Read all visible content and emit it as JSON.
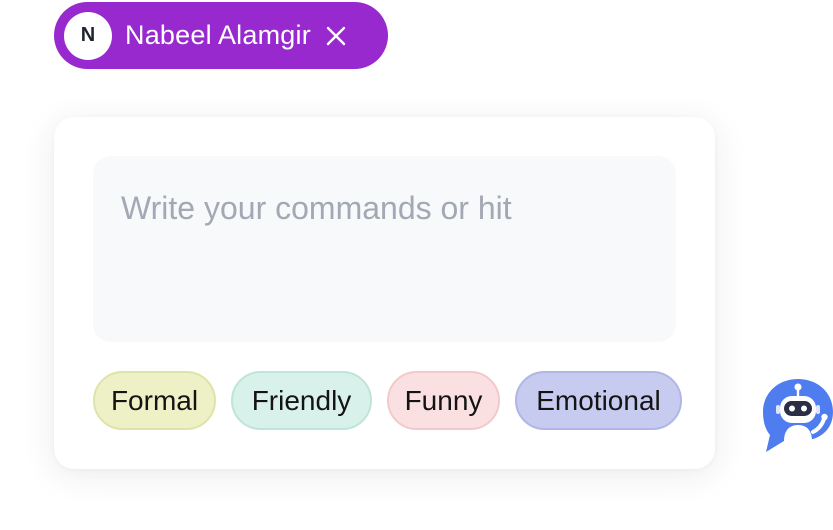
{
  "user_chip": {
    "initial": "N",
    "name": "Nabeel Alamgir",
    "background": "#9729cf"
  },
  "composer": {
    "placeholder": "Write your commands or hit"
  },
  "tones": [
    {
      "label": "Formal",
      "color": "#eef1c6"
    },
    {
      "label": "Friendly",
      "color": "#d8f1ea"
    },
    {
      "label": "Funny",
      "color": "#fbe0e2"
    },
    {
      "label": "Emotional",
      "color": "#c7cbef"
    }
  ],
  "assistant": {
    "icon": "robot-icon",
    "color": "#4f7df0"
  }
}
